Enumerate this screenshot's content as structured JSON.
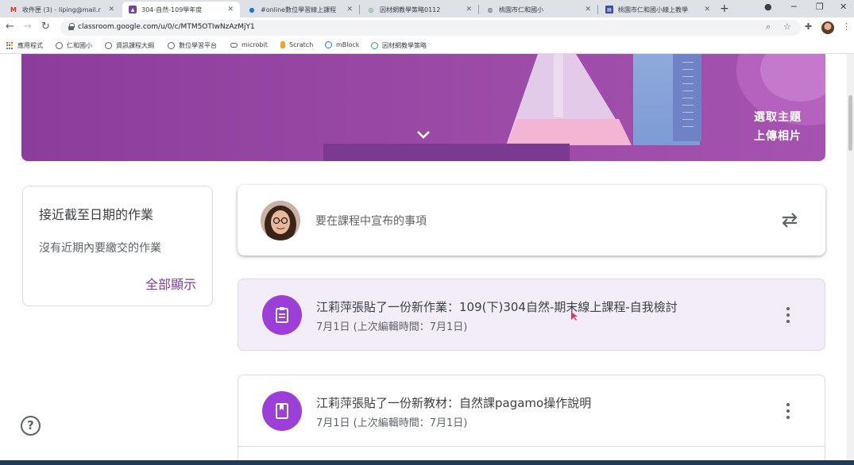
{
  "browser": {
    "tabs": [
      {
        "title": "收件匣 (3) - liping@mail.r",
        "icon": "gmail-icon",
        "active": false
      },
      {
        "title": "304-自然-109學年度",
        "icon": "classroom-icon",
        "active": true
      },
      {
        "title": "#online數位學習線上課程",
        "icon": "edge-icon",
        "active": false
      },
      {
        "title": "因材網教學策略0112",
        "icon": "adaptive-icon",
        "active": false
      },
      {
        "title": "桃園市仁和國小",
        "icon": "globe-icon",
        "active": false
      },
      {
        "title": "桃園市仁和國小線上教學",
        "icon": "sites-icon",
        "active": false
      }
    ],
    "new_tab": "+",
    "url": "classroom.google.com/u/0/c/MTM5OTIwNzAzMjY1",
    "bookmarks": [
      {
        "label": "應用程式",
        "icon": "apps-grid-icon"
      },
      {
        "label": "仁和國小",
        "icon": "globe-icon"
      },
      {
        "label": "資訊課程大綱",
        "icon": "globe-icon"
      },
      {
        "label": "數位學習平台",
        "icon": "globe-icon"
      },
      {
        "label": "microbit",
        "icon": "link-icon"
      },
      {
        "label": "Scratch",
        "icon": "scratch-icon"
      },
      {
        "label": "mBlock",
        "icon": "mblock-icon"
      },
      {
        "label": "因材網教學策略",
        "icon": "adaptive-icon"
      }
    ]
  },
  "banner": {
    "select_theme": "選取主題",
    "upload_photo": "上傳相片"
  },
  "upcoming": {
    "title": "接近截至日期的作業",
    "empty": "沒有近期內要繳交的作業",
    "view_all": "全部顯示"
  },
  "announce": {
    "prompt": "要在課程中宣布的事項"
  },
  "posts": [
    {
      "title": "江莉萍張貼了一份新作業：109(下)304自然-期末線上課程-自我檢討",
      "date": "7月1日 (上次編輯時間：7月1日)",
      "type": "assignment"
    },
    {
      "title": "江莉萍張貼了一份新教材：自然課pagamo操作說明",
      "date": "7月1日 (上次編輯時間：7月1日)",
      "type": "material"
    }
  ],
  "colors": {
    "banner": "#9b4aa6",
    "accent": "#9c3fd8",
    "link": "#7b3fa3",
    "highlight_bg": "#f3ecf9"
  }
}
